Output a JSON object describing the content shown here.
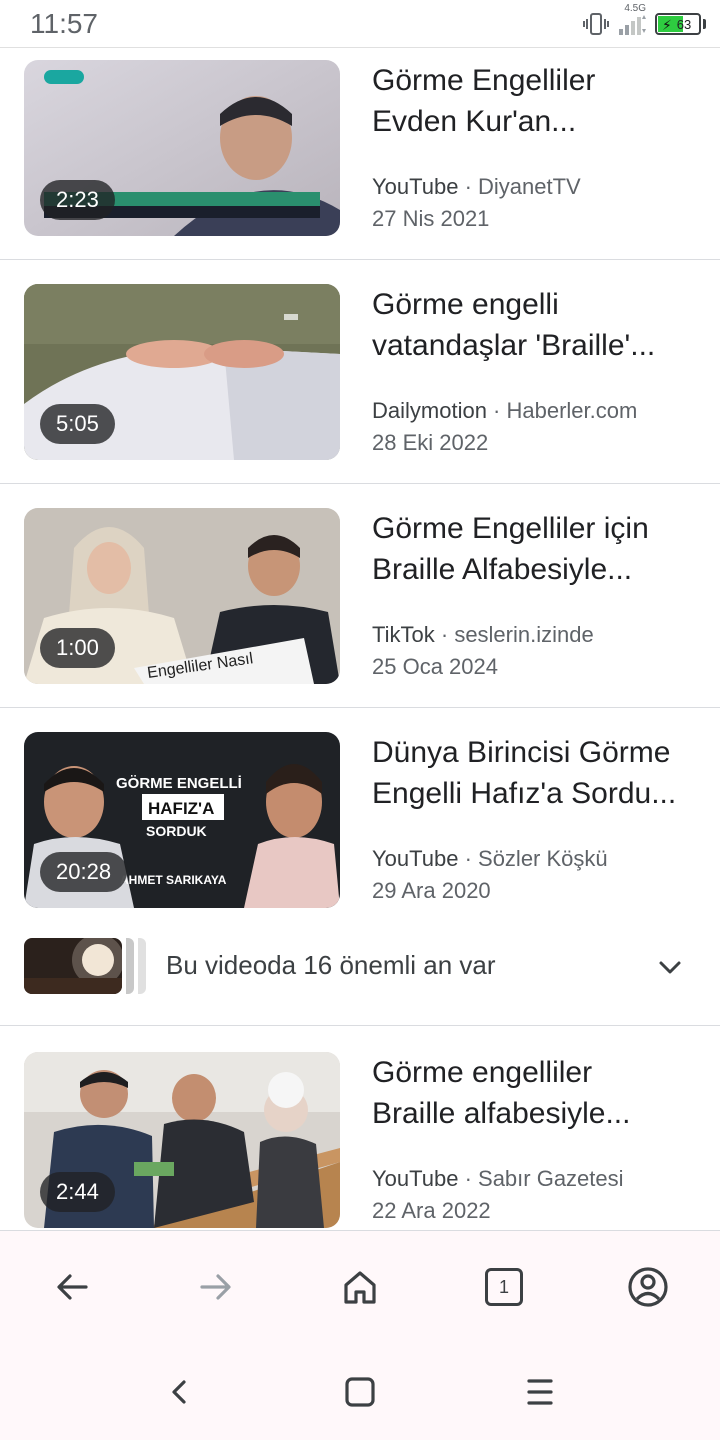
{
  "status_bar": {
    "time": "11:57",
    "network": "4.5G",
    "battery": "63",
    "battery_level": 0.63,
    "battery_color": "#2ecc40",
    "icons": [
      "vibrate-icon",
      "signal-icon",
      "battery-icon"
    ]
  },
  "results": [
    {
      "title_line1": "Görme Engelliler",
      "title_line2": "Evden Kur'an...",
      "source": "YouTube",
      "channel": "DiyanetTV",
      "date": "27 Nis 2021",
      "duration": "2:23"
    },
    {
      "title_line1": "Görme engelli",
      "title_line2": "vatandaşlar 'Braille'...",
      "source": "Dailymotion",
      "channel": "Haberler.com",
      "date": "28 Eki 2022",
      "duration": "5:05"
    },
    {
      "title_line1": "Görme Engelliler için",
      "title_line2": "Braille Alfabesiyle...",
      "source": "TikTok",
      "channel": "seslerin.izinde",
      "date": "25 Oca 2024",
      "duration": "1:00",
      "thumb_caption": "Engelliler Nasıl"
    },
    {
      "title_line1": "Dünya Birincisi Görme",
      "title_line2": "Engelli Hafız'a Sordu...",
      "source": "YouTube",
      "channel": "Sözler Köşkü",
      "date": "29 Ara 2020",
      "duration": "20:28",
      "thumb_text": [
        "GÖRME ENGELLİ",
        "HAFIZ'A",
        "SORDUK",
        "AHMET SARIKAYA"
      ]
    },
    {
      "title_line1": "Görme engelliler",
      "title_line2": "Braille alfabesiyle...",
      "source": "YouTube",
      "channel": "Sabır Gazetesi",
      "date": "22 Ara 2022",
      "duration": "2:44"
    }
  ],
  "moments": {
    "text": "Bu videoda 16 önemli an var"
  },
  "toolbar": {
    "tab_count": "1",
    "icons": [
      "back-arrow-icon",
      "forward-arrow-icon",
      "home-icon",
      "tab-switcher-icon",
      "account-icon"
    ]
  },
  "nav": {
    "icons": [
      "nav-back-icon",
      "nav-home-icon",
      "nav-menu-icon"
    ]
  }
}
